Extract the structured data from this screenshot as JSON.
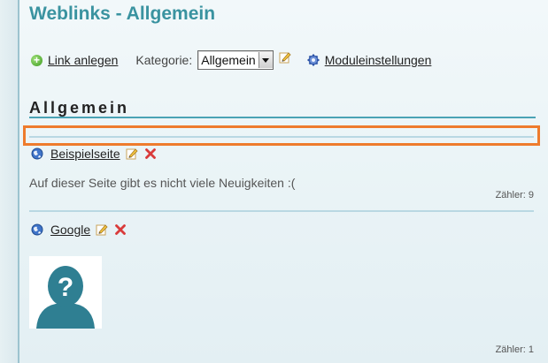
{
  "page": {
    "title": "Weblinks - Allgemein"
  },
  "toolbar": {
    "add_link_label": "Link anlegen",
    "category_label": "Kategorie:",
    "category_selected": "Allgemein",
    "module_settings_label": "Moduleinstellungen"
  },
  "section": {
    "heading": "Allgemein"
  },
  "links": [
    {
      "title": "Beispielseite",
      "description": "Auf dieser Seite gibt es nicht viele Neuigkeiten :(",
      "counter": "Zähler: 9"
    },
    {
      "title": "Google",
      "counter": "Zähler: 1"
    }
  ],
  "colors": {
    "title": "#3a93a0",
    "accent_line": "#4aa3b5",
    "highlight": "#ee7b2d",
    "delete": "#d93b3b"
  },
  "icons": [
    "plus-icon",
    "pencil-icon",
    "gear-icon",
    "globe-icon",
    "delete-icon",
    "avatar-placeholder-icon"
  ]
}
